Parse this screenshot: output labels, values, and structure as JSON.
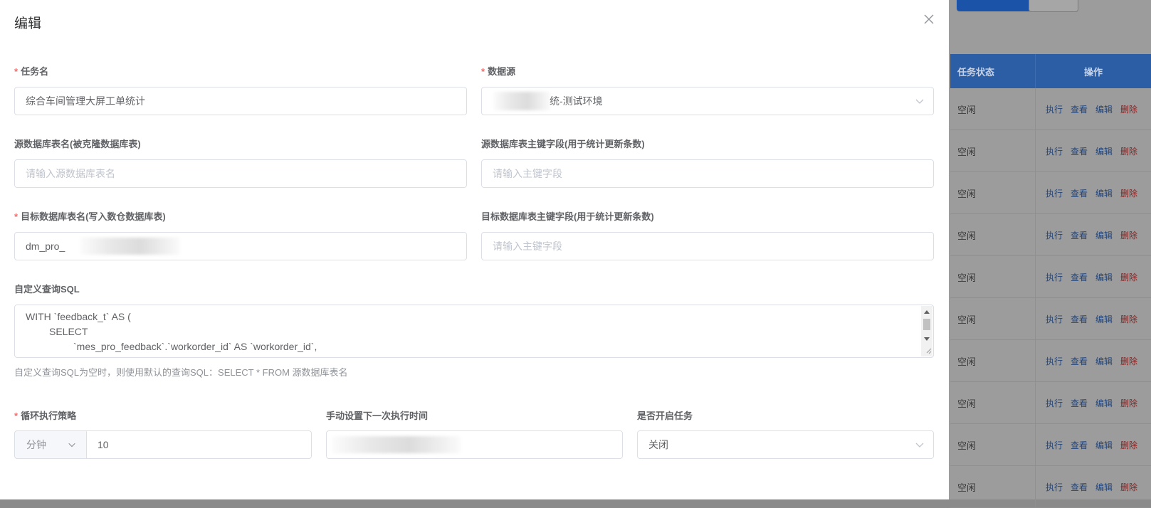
{
  "dialog": {
    "title": "编辑",
    "close_icon": "close-icon",
    "fields": {
      "task_name": {
        "label": "任务名",
        "value": "综合车间管理大屏工单统计",
        "required": true
      },
      "datasource": {
        "label": "数据源",
        "value": "统-测试环境",
        "required": true
      },
      "source_table": {
        "label": "源数据库表名(被克隆数据库表)",
        "placeholder": "请输入源数据库表名"
      },
      "source_pk": {
        "label": "源数据库表主键字段(用于统计更新条数)",
        "placeholder": "请输入主键字段"
      },
      "target_table": {
        "label": "目标数据库表名(写入数仓数据库表)",
        "value": "dm_pro_",
        "required": true
      },
      "target_pk": {
        "label": "目标数据库表主键字段(用于统计更新条数)",
        "placeholder": "请输入主键字段"
      },
      "sql": {
        "label": "自定义查询SQL",
        "lines": [
          "WITH `feedback_t` AS (",
          "SELECT",
          "`mes_pro_feedback`.`workorder_id` AS `workorder_id`,"
        ],
        "hint": "自定义查询SQL为空时，则使用默认的查询SQL：SELECT * FROM 源数据库表名"
      },
      "loop": {
        "label": "循环执行策略",
        "unit": "分钟",
        "value": "10",
        "required": true
      },
      "next_time": {
        "label": "手动设置下一次执行时间"
      },
      "enabled": {
        "label": "是否开启任务",
        "value": "关闭"
      }
    }
  },
  "background": {
    "table": {
      "headers": [
        "任务状态",
        "操作"
      ],
      "rows": [
        {
          "status": "空闲"
        },
        {
          "status": "空闲"
        },
        {
          "status": "空闲"
        },
        {
          "status": "空闲"
        },
        {
          "status": "空闲"
        },
        {
          "status": "空闲"
        },
        {
          "status": "空闲"
        },
        {
          "status": "空闲"
        },
        {
          "status": "空闲"
        },
        {
          "status": "空闲"
        }
      ],
      "actions": [
        "执行",
        "查看",
        "编辑",
        "删除"
      ]
    }
  },
  "colors": {
    "required": "#f56c6c",
    "primary_dark": "#2c5ea6",
    "mask": "#8a8a8a"
  }
}
